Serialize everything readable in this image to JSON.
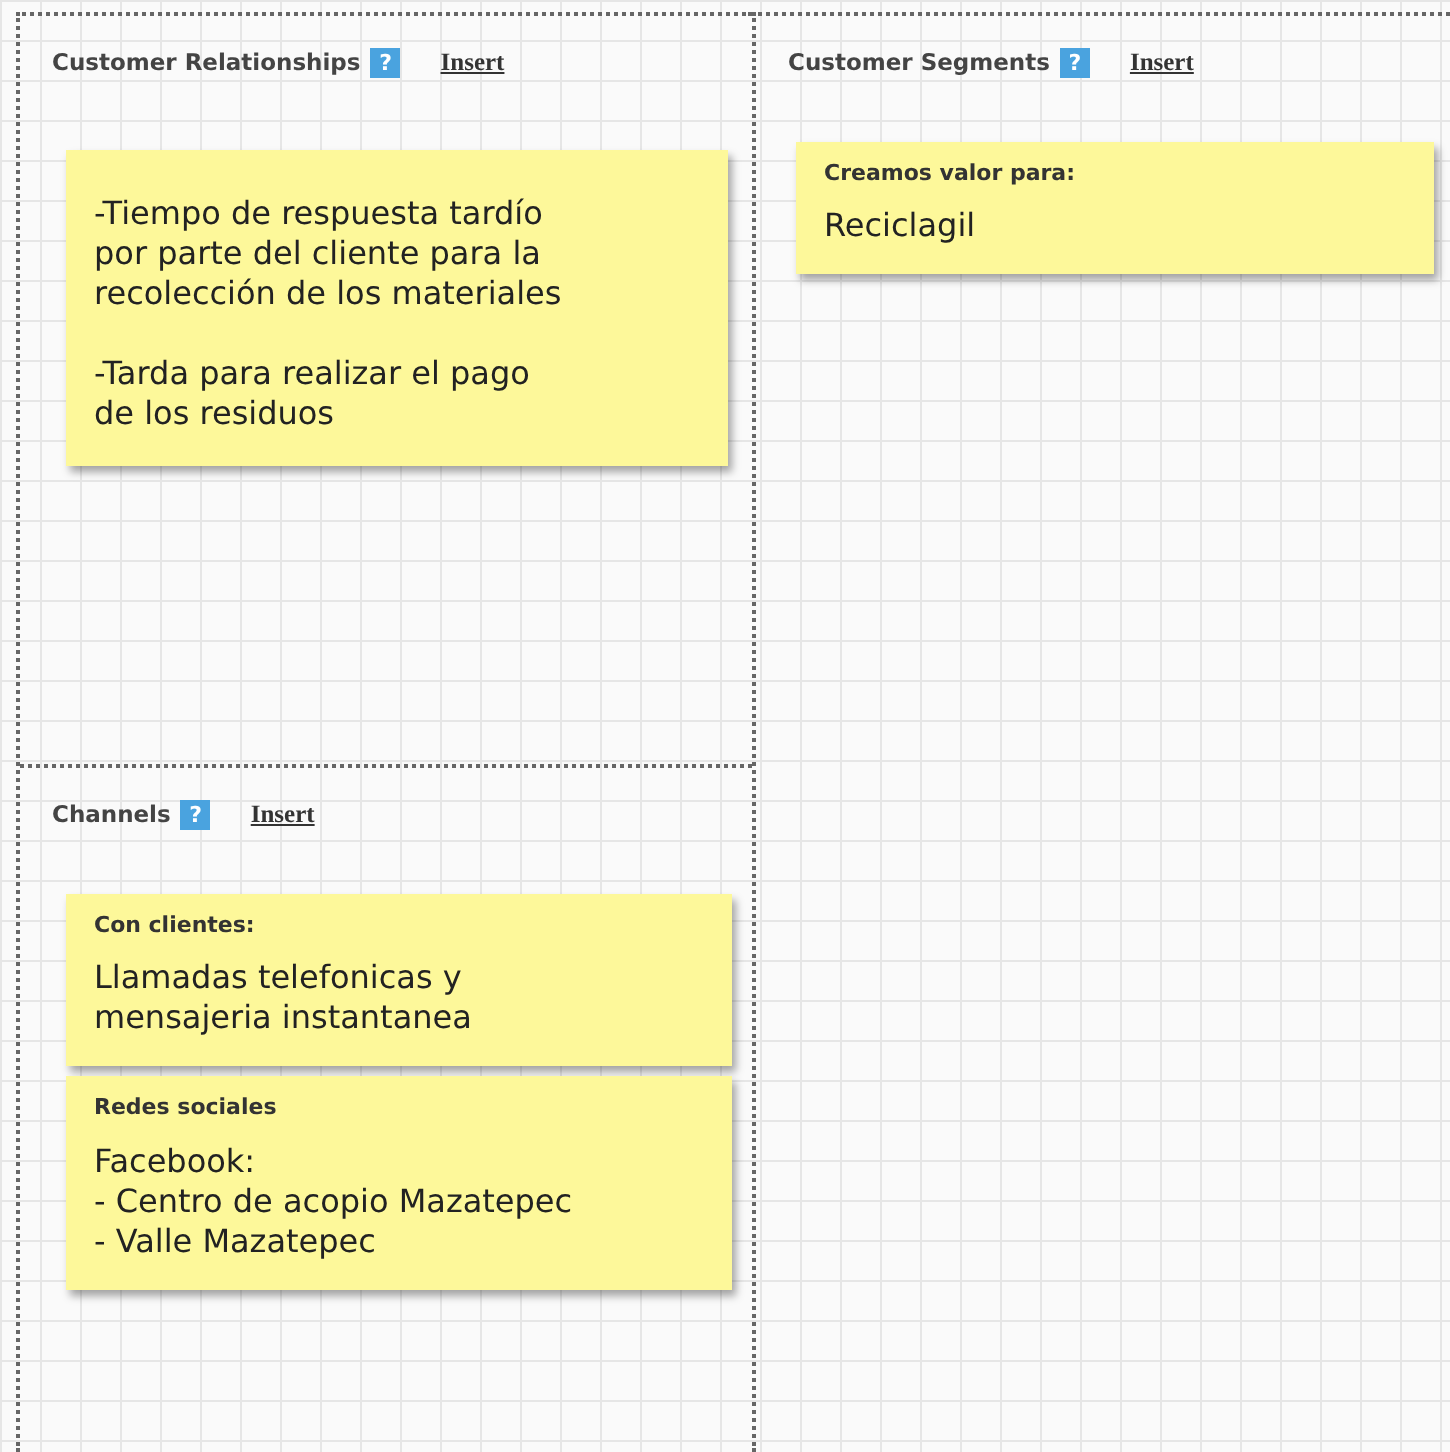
{
  "panels": [
    {
      "title": "Customer Relationships",
      "help": "?",
      "action": "Insert",
      "notes": [
        {
          "paragraphs": [
            [
              "-Tiempo de respuesta tardío",
              "por parte del cliente para la",
              "recolección de los materiales"
            ],
            [
              "-Tarda para realizar el pago",
              "de los residuos"
            ]
          ]
        }
      ]
    },
    {
      "title": "Channels",
      "help": "?",
      "action": "Insert",
      "notes": [
        {
          "heading": "Con clientes:",
          "paragraphs": [
            [
              "Llamadas telefonicas y",
              "mensajeria instantanea"
            ]
          ]
        },
        {
          "heading": "Redes sociales",
          "paragraphs": [
            [
              "Facebook:",
              "- Centro de acopio Mazatepec",
              "- Valle Mazatepec"
            ]
          ]
        }
      ]
    },
    {
      "title": "Customer Segments",
      "help": "?",
      "action": "Insert",
      "notes": [
        {
          "heading": "Creamos valor para:",
          "paragraphs": [
            [
              "Reciclagil"
            ]
          ]
        }
      ]
    }
  ]
}
